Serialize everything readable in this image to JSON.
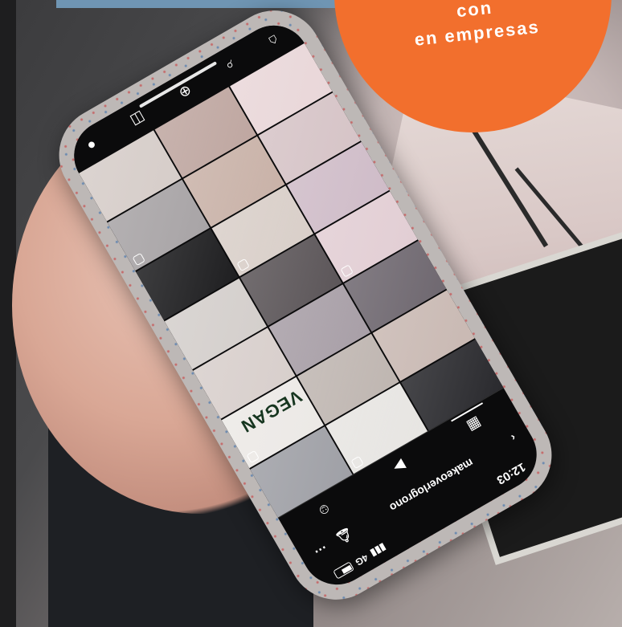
{
  "badge": {
    "line1": "con",
    "line2": "en empresas",
    "color": "#f26f2d"
  },
  "phone": {
    "status_bar": {
      "time": "12:03",
      "network": "4G"
    },
    "profile": {
      "username": "makeoverlogrono"
    },
    "tiles": [
      {
        "color": "#2a2a2e",
        "image_name": "hair-photo"
      },
      {
        "color": "#e7e5e2",
        "image_name": "hair-photo"
      },
      {
        "color": "#9fa0a6",
        "image_name": "hair-photo"
      },
      {
        "color": "#c9b9b3",
        "image_name": "salon-photo"
      },
      {
        "color": "#bfb6b1",
        "image_name": "hair-photo"
      },
      {
        "color": "#ece9e6",
        "image_name": "vegan-photo",
        "text": "VEGAN"
      },
      {
        "color": "#6f6870",
        "image_name": "hair-photo"
      },
      {
        "color": "#a89fa7",
        "image_name": "hair-photo"
      },
      {
        "color": "#d8cfcc",
        "image_name": "hair-photo"
      },
      {
        "color": "#e2ced4",
        "image_name": "nails-photo"
      },
      {
        "color": "#5c5659",
        "image_name": "makeup-photo"
      },
      {
        "color": "#d4cfcc",
        "image_name": "hair-photo"
      },
      {
        "color": "#cfbcc8",
        "image_name": "nails-photo"
      },
      {
        "color": "#d9cfc9",
        "image_name": "hair-photo"
      },
      {
        "color": "#1f1f21",
        "image_name": "hair-photo"
      },
      {
        "color": "#d6c4c7",
        "image_name": "hair-photo"
      },
      {
        "color": "#c9b2a8",
        "image_name": "hair-photo"
      },
      {
        "color": "#a8a4a6",
        "image_name": "hair-photo"
      },
      {
        "color": "#e9d7d9",
        "image_name": "hair-photo"
      },
      {
        "color": "#bfa7a1",
        "image_name": "hair-photo"
      },
      {
        "color": "#d6cdc9",
        "image_name": "hair-photo"
      }
    ]
  }
}
